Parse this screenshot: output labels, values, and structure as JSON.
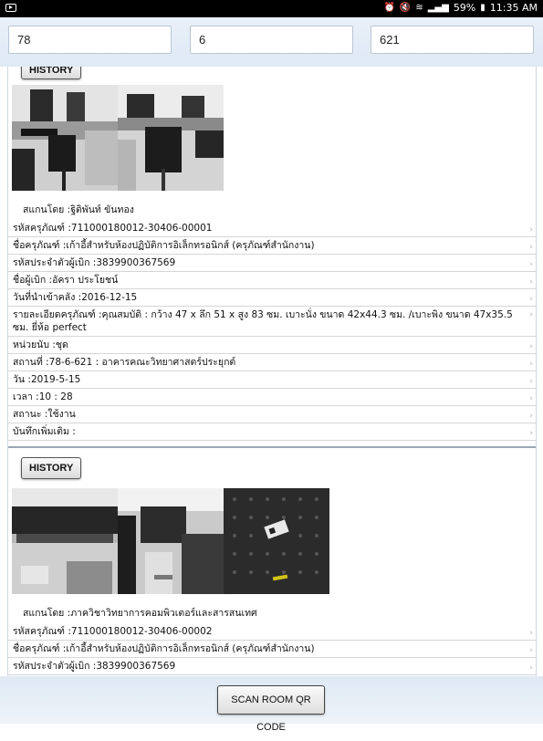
{
  "statusbar": {
    "battery": "59%",
    "time": "11:35 AM"
  },
  "inputs": {
    "building": "78",
    "floor": "6",
    "room": "621"
  },
  "records": [
    {
      "history_label": "HISTORY",
      "scanned_by": "สแกนโดย :ฐิติพันท์  ขันทอง",
      "fields": [
        "รหัสครุภัณฑ์ :711000180012-30406-00001",
        "ชื่อครุภัณฑ์ :เก้าอี้สำหรับห้องปฏิบัติการอิเล็กทรอนิกส์ (ครุภัณฑ์สำนักงาน)",
        "รหัสประจำตัวผู้เบิก :3839900367569",
        "ชื่อผู้เบิก :อัครา ประโยชน์",
        "วันที่นำเข้าคลัง :2016-12-15",
        "รายละเอียดครุภัณฑ์ :คุณสมบัติ : กว้าง 47 x ลึก 51 x สูง 83 ซม. เบาะนั่ง ขนาด 42x44.3 ซม. /เบาะพิง ขนาด 47x35.5 ซม. ยี่ห้อ perfect",
        "หน่วยนับ :ชุด",
        "สถานที่ :78-6-621 : อาคารคณะวิทยาศาสตร์ประยุกต์",
        "วัน :2019-5-15",
        "เวลา :10 : 28",
        "สถานะ :ใช้งาน",
        "บันทึกเพิ่มเติม :"
      ]
    },
    {
      "history_label": "HISTORY",
      "scanned_by": "สแกนโดย :ภาควิชาวิทยาการคอมพิวเตอร์และสารสนเทศ",
      "fields": [
        "รหัสครุภัณฑ์ :711000180012-30406-00002",
        "ชื่อครุภัณฑ์ :เก้าอี้สำหรับห้องปฏิบัติการอิเล็กทรอนิกส์ (ครุภัณฑ์สำนักงาน)",
        "รหัสประจำตัวผู้เบิก :3839900367569"
      ]
    }
  ],
  "bottom": {
    "scan_button": "SCAN ROOM QR CODE"
  }
}
